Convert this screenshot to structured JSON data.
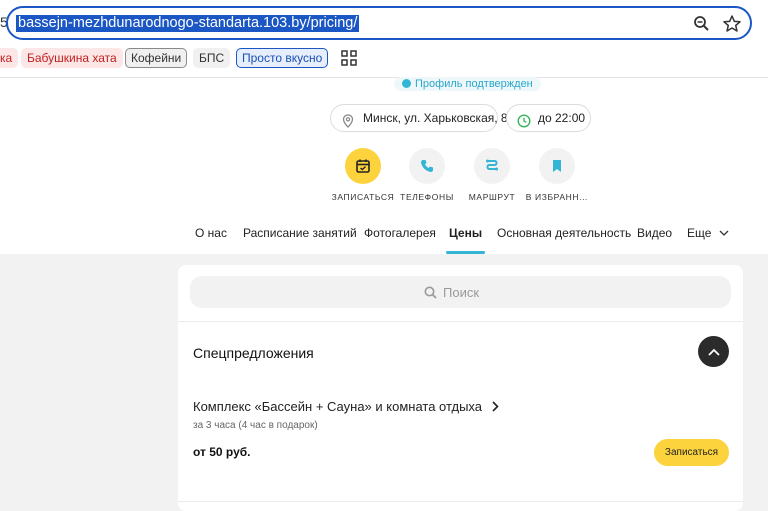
{
  "browser": {
    "url": "bassejn-mezhdunarodnogo-standarta.103.by/pricing/",
    "back_fragment": "5",
    "bookmarks": [
      {
        "label": "ка",
        "style": "red"
      },
      {
        "label": "Бабушкина хата",
        "style": "red"
      },
      {
        "label": "Кофейни",
        "style": "gray"
      },
      {
        "label": "БПС",
        "style": "plain"
      },
      {
        "label": "Просто вкусно",
        "style": "blue"
      }
    ]
  },
  "header": {
    "verified_text": "Профиль подтвержден",
    "address": "Минск, ул. Харьковская, 8",
    "hours": "до 22:00",
    "actions": [
      {
        "label": "ЗАПИСАТЬСЯ",
        "icon": "calendar-icon"
      },
      {
        "label": "ТЕЛЕФОНЫ",
        "icon": "phone-icon"
      },
      {
        "label": "МАРШРУТ",
        "icon": "route-icon"
      },
      {
        "label": "В ИЗБРАНН…",
        "icon": "bookmark-icon"
      }
    ],
    "tabs": [
      "О нас",
      "Расписание занятий",
      "Фотогалерея",
      "Цены",
      "Основная деятельность",
      "Видео",
      "Еще"
    ],
    "active_tab": "Цены"
  },
  "main": {
    "search_placeholder": "Поиск",
    "section_title": "Спецпредложения",
    "offer": {
      "title": "Комплекс «Бассейн + Сауна» и комната отдыха",
      "subtitle": "за 3 часа (4 час в подарок)",
      "price": "от 50 руб.",
      "button": "Записаться"
    }
  },
  "colors": {
    "accent": "#35b5d6",
    "primary_button": "#fcd33d",
    "url_highlight": "#1a56c4"
  }
}
